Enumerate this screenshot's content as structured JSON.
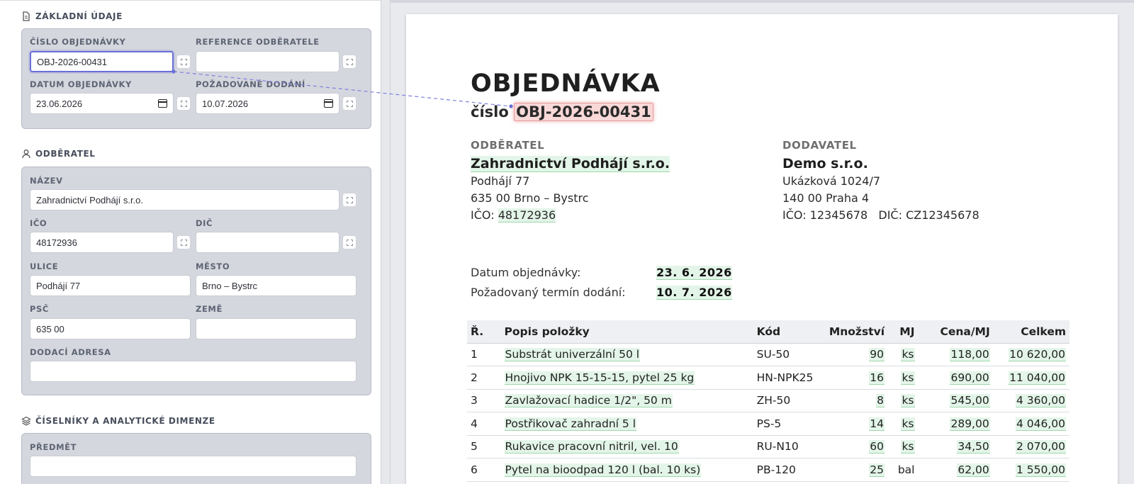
{
  "form": {
    "basic": {
      "title": "ZÁKLADNÍ ÚDAJE",
      "order_number_label": "ČÍSLO OBJEDNÁVKY",
      "order_number_value": "OBJ-2026-00431",
      "customer_ref_label": "REFERENCE ODBĚRATELE",
      "customer_ref_value": "",
      "order_date_label": "DATUM OBJEDNÁVKY",
      "order_date_value": "23.06.2026",
      "delivery_date_label": "POŽADOVANÉ DODÁNÍ",
      "delivery_date_value": "10.07.2026"
    },
    "customer": {
      "title": "ODBĚRATEL",
      "name_label": "NÁZEV",
      "name_value": "Zahradnictví Podhájí s.r.o.",
      "ico_label": "IČO",
      "ico_value": "48172936",
      "dic_label": "DIČ",
      "dic_value": "",
      "street_label": "ULICE",
      "street_value": "Podhájí 77",
      "city_label": "MĚSTO",
      "city_value": "Brno – Bystrc",
      "zip_label": "PSČ",
      "zip_value": "635 00",
      "country_label": "ZEMĚ",
      "country_value": "",
      "delivery_address_label": "DODACÍ ADRESA",
      "delivery_address_value": ""
    },
    "dimensions": {
      "title": "ČÍSELNÍKY A ANALYTICKÉ DIMENZE",
      "subject_label": "PŘEDMĚT",
      "subject_value": ""
    }
  },
  "document": {
    "title": "OBJEDNÁVKA",
    "number_prefix": "číslo",
    "number": "OBJ-2026-00431",
    "customer": {
      "heading": "ODBĚRATEL",
      "name": "Zahradnictví Podhájí s.r.o.",
      "street": "Podhájí 77",
      "city": "635 00 Brno – Bystrc",
      "ico_label": "IČO:",
      "ico": "48172936"
    },
    "supplier": {
      "heading": "DODAVATEL",
      "name": "Demo s.r.o.",
      "street": "Ukázková 1024/7",
      "city": "140 00 Praha 4",
      "ids": "IČO: 12345678   DIČ: CZ12345678"
    },
    "order_date_label": "Datum objednávky:",
    "order_date": "23. 6. 2026",
    "delivery_date_label": "Požadovaný termín dodání:",
    "delivery_date": "10. 7. 2026",
    "table": {
      "headers": [
        "Ř.",
        "Popis položky",
        "Kód",
        "Množství",
        "MJ",
        "Cena/MJ",
        "Celkem"
      ],
      "rows": [
        {
          "n": "1",
          "desc": "Substrát univerzální 50 l",
          "code": "SU-50",
          "qty": "90",
          "unit": "ks",
          "price": "118,00",
          "total": "10 620,00"
        },
        {
          "n": "2",
          "desc": "Hnojivo NPK 15-15-15, pytel 25 kg",
          "code": "HN-NPK25",
          "qty": "16",
          "unit": "ks",
          "price": "690,00",
          "total": "11 040,00"
        },
        {
          "n": "3",
          "desc": "Zavlažovací hadice 1/2\", 50 m",
          "code": "ZH-50",
          "qty": "8",
          "unit": "ks",
          "price": "545,00",
          "total": "4 360,00"
        },
        {
          "n": "4",
          "desc": "Postřikovač zahradní 5 l",
          "code": "PS-5",
          "qty": "14",
          "unit": "ks",
          "price": "289,00",
          "total": "4 046,00"
        },
        {
          "n": "5",
          "desc": "Rukavice pracovní nitril, vel. 10",
          "code": "RU-N10",
          "qty": "60",
          "unit": "ks",
          "price": "34,50",
          "total": "2 070,00"
        },
        {
          "n": "6",
          "desc": "Pytel na bioodpad 120 l (bal. 10 ks)",
          "code": "PB-120",
          "qty": "25",
          "unit": "bal",
          "price": "62,00",
          "total": "1 550,00"
        }
      ]
    }
  },
  "colors": {
    "accent": "#6a6fd8",
    "highlight_red": "#f9d8d8",
    "highlight_green": "#e3f5e8",
    "card_bg": "#d5d7de"
  },
  "icons": {
    "basic_section": "document-icon",
    "customer_section": "user-icon",
    "dimensions_section": "layers-icon",
    "date_picker": "calendar-icon",
    "field_link": "dashed-square-icon"
  }
}
